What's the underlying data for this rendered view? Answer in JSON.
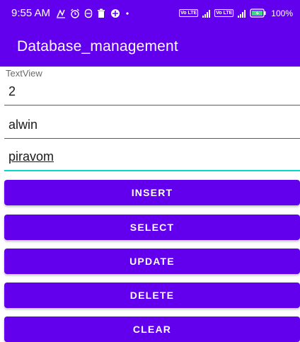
{
  "status_bar": {
    "time": "9:55 AM",
    "icons_left": [
      "gesture-icon",
      "alarm-icon",
      "data-saver-icon",
      "delete-icon",
      "game-icon",
      "dot-icon"
    ],
    "sim1_label": "Vo LTE",
    "sim2_label": "Vo LTE",
    "battery_percent": "100%"
  },
  "app_bar": {
    "title": "Database_management"
  },
  "textview_label": "TextView",
  "fields": [
    {
      "value": "2"
    },
    {
      "value": "alwin"
    },
    {
      "value": "piravom"
    }
  ],
  "buttons": {
    "insert": "INSERT",
    "select": "SELECT",
    "update": "UPDATE",
    "delete": "DELETE",
    "clear": "CLEAR"
  },
  "colors": {
    "primary": "#6200ee",
    "accent": "#03dac5"
  }
}
